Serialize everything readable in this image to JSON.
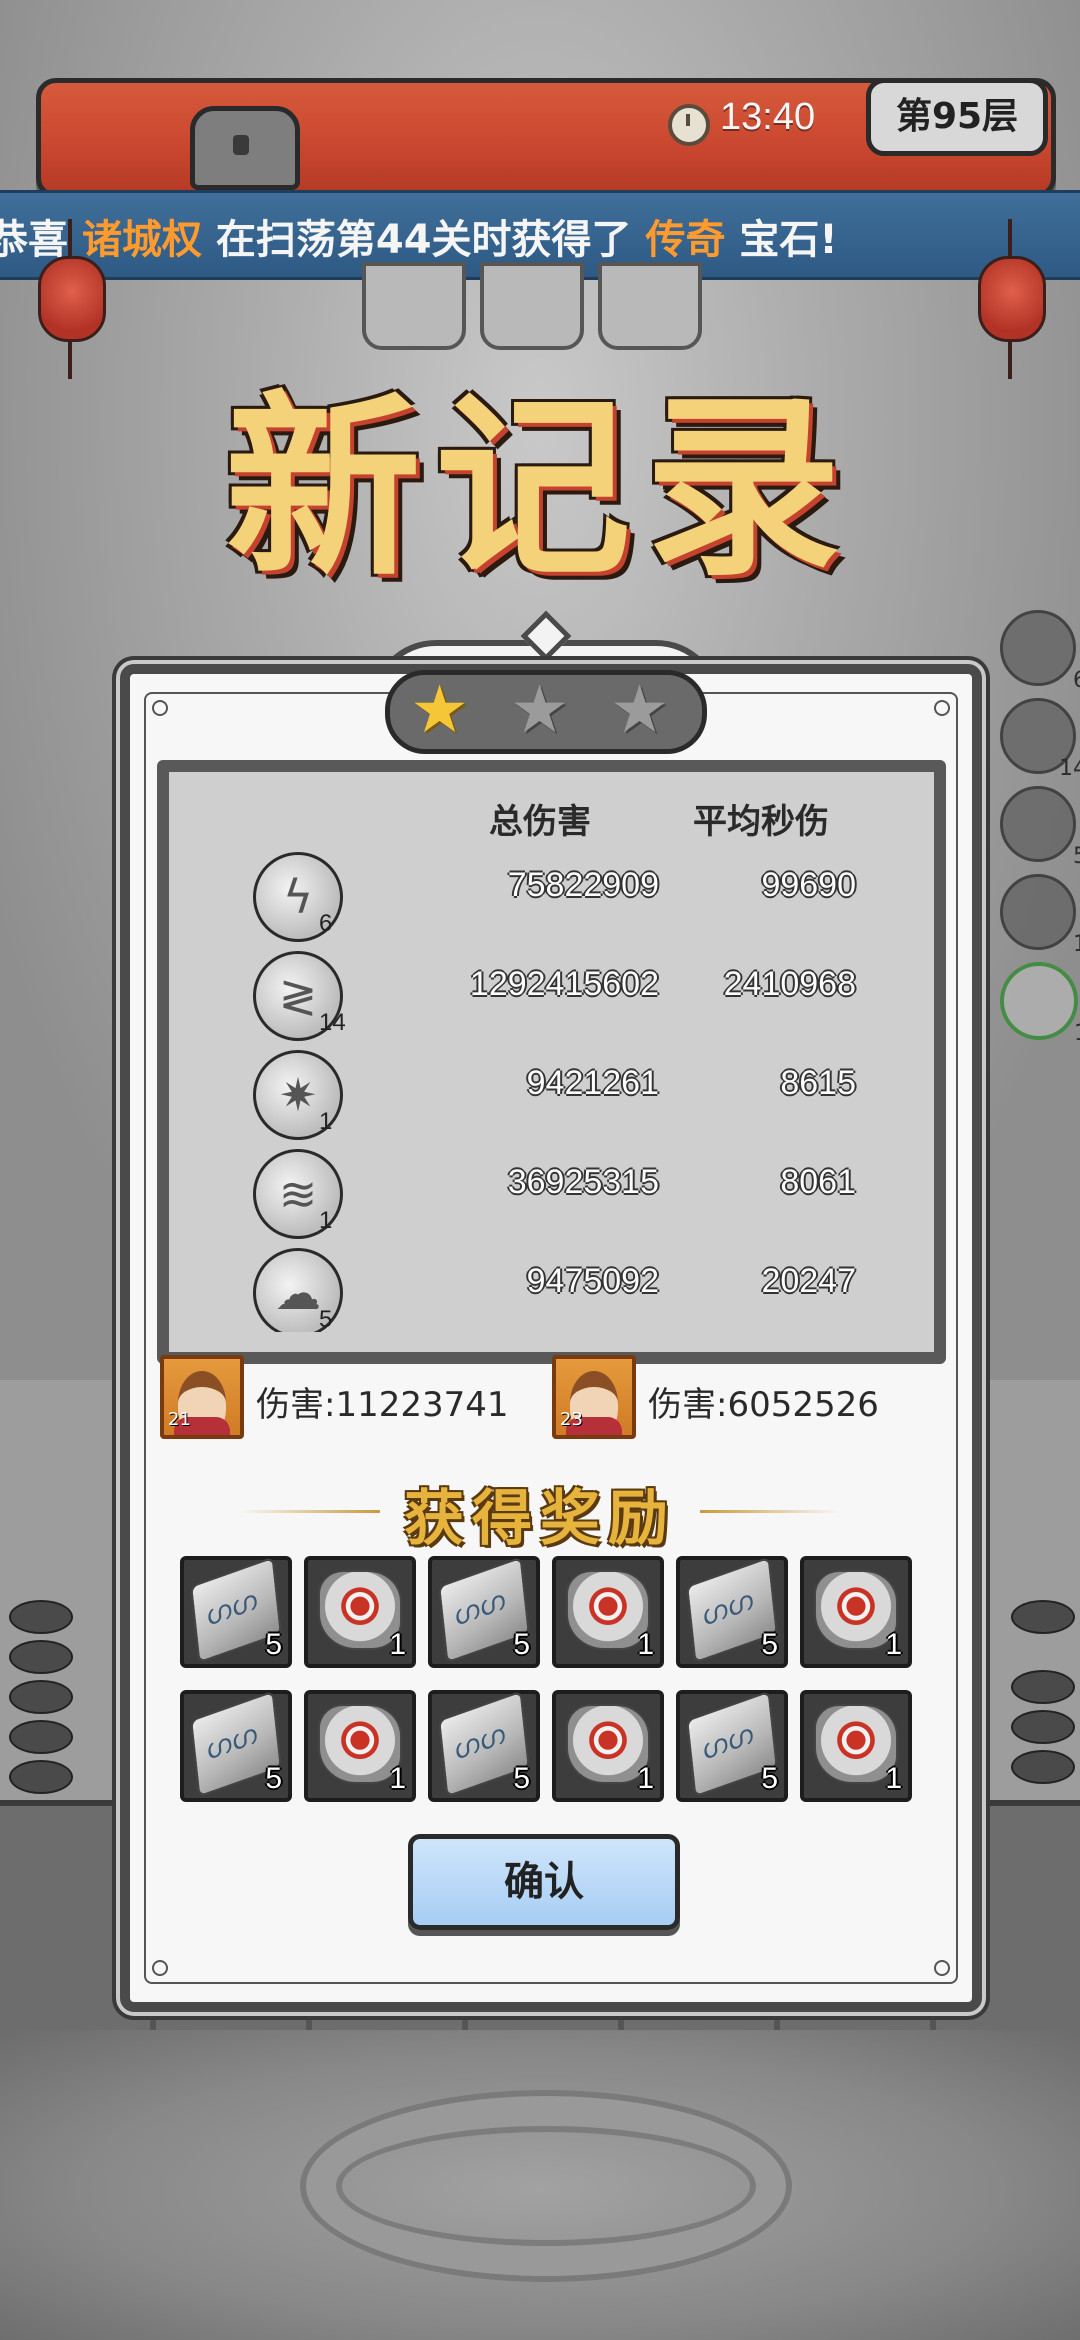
{
  "hud": {
    "time": "13:40",
    "floor": "第95层"
  },
  "marquee": {
    "prefix": "恭喜 ",
    "player": "诸城权",
    "middle": " 在扫荡第44关时获得了 ",
    "item": "传奇",
    "suffix": " 宝石!"
  },
  "title": "新记录",
  "stars": {
    "earned": 1,
    "total": 3
  },
  "stats": {
    "header_total": "总伤害",
    "header_dps": "平均秒伤",
    "rows": [
      {
        "icon": "lightning-orb-icon",
        "level": "6",
        "total": "75822909",
        "dps": "99690"
      },
      {
        "icon": "chain-lightning-icon",
        "level": "14",
        "total": "1292415602",
        "dps": "2410968"
      },
      {
        "icon": "crystal-burst-icon",
        "level": "1",
        "total": "9421261",
        "dps": "8615"
      },
      {
        "icon": "tornado-icon",
        "level": "1",
        "total": "36925315",
        "dps": "8061"
      },
      {
        "icon": "storm-cloud-icon",
        "level": "5",
        "total": "9475092",
        "dps": "20247"
      }
    ]
  },
  "heroes": [
    {
      "level": "21",
      "damage": "伤害:11223741"
    },
    {
      "level": "23",
      "damage": "伤害:6052526"
    }
  ],
  "rewards": {
    "title": "获得奖励",
    "items": [
      {
        "type": "iron-bar-icon",
        "count": "5"
      },
      {
        "type": "red-gem-ore-icon",
        "count": "1"
      },
      {
        "type": "iron-bar-icon",
        "count": "5"
      },
      {
        "type": "red-gem-ore-icon",
        "count": "1"
      },
      {
        "type": "iron-bar-icon",
        "count": "5"
      },
      {
        "type": "red-gem-ore-icon",
        "count": "1"
      },
      {
        "type": "iron-bar-icon",
        "count": "5"
      },
      {
        "type": "red-gem-ore-icon",
        "count": "1"
      },
      {
        "type": "iron-bar-icon",
        "count": "5"
      },
      {
        "type": "red-gem-ore-icon",
        "count": "1"
      },
      {
        "type": "iron-bar-icon",
        "count": "5"
      },
      {
        "type": "red-gem-ore-icon",
        "count": "1"
      }
    ]
  },
  "confirm": "确认",
  "side_skills": [
    {
      "level": "6"
    },
    {
      "level": "14"
    },
    {
      "level": "5"
    },
    {
      "level": "1"
    },
    {
      "level": "1"
    }
  ]
}
